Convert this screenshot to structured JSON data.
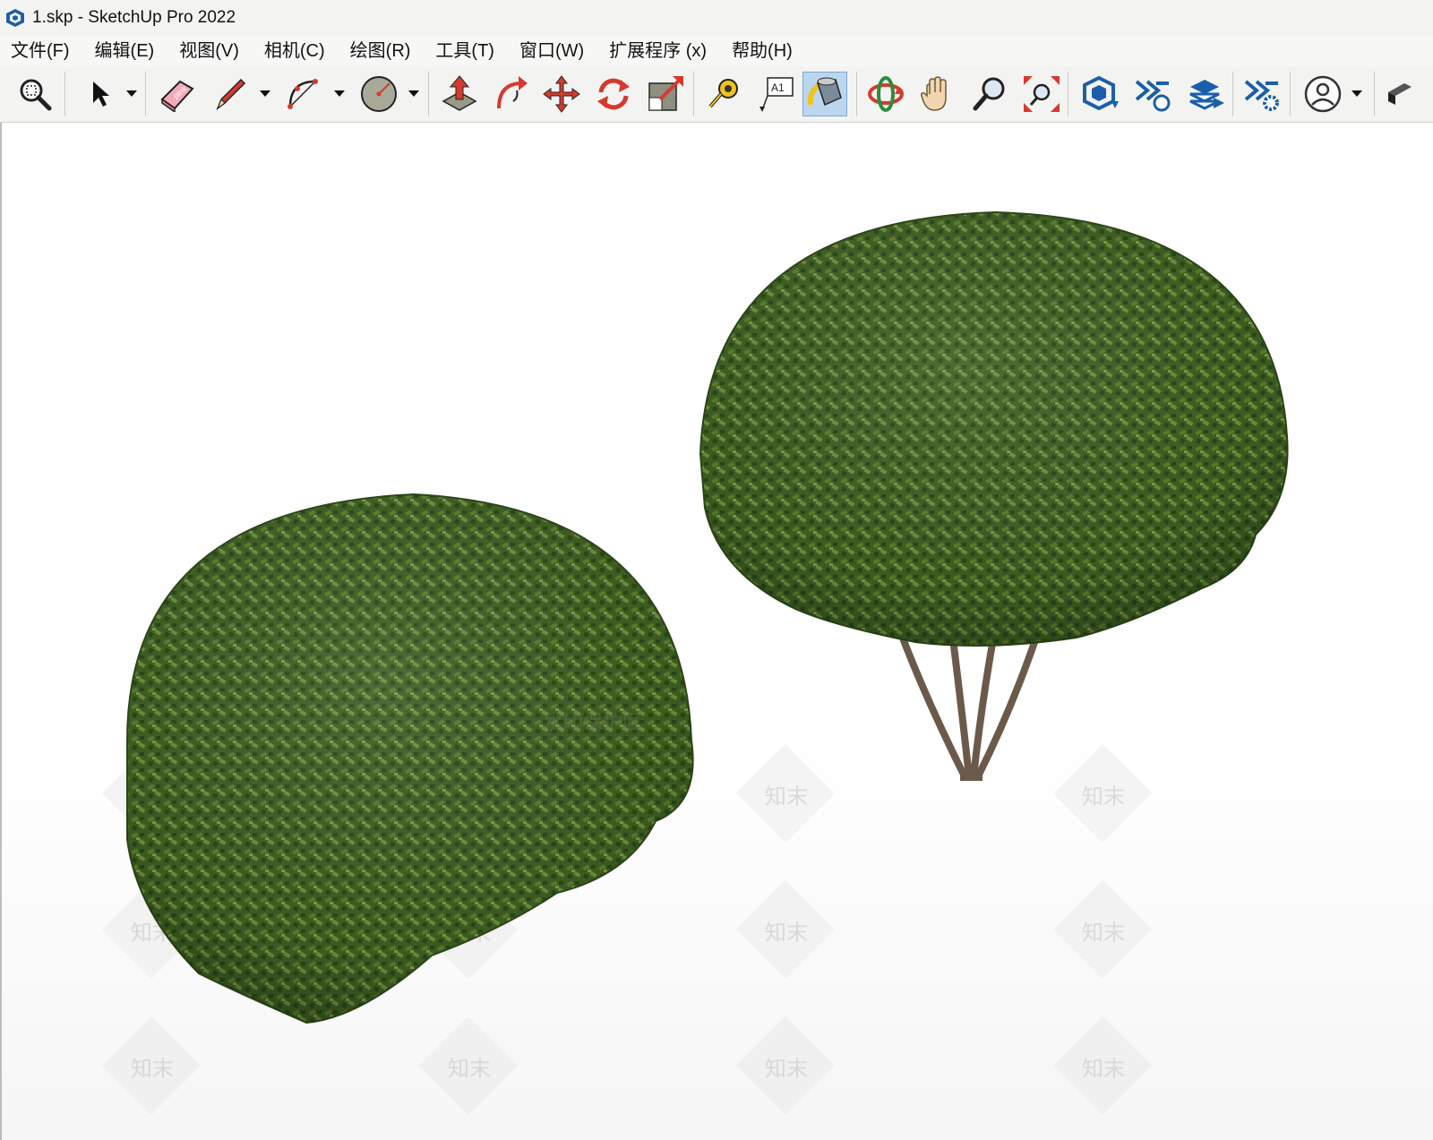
{
  "window": {
    "title": "1.skp - SketchUp Pro 2022"
  },
  "menu": [
    {
      "label": "文件(F)"
    },
    {
      "label": "编辑(E)"
    },
    {
      "label": "视图(V)"
    },
    {
      "label": "相机(C)"
    },
    {
      "label": "绘图(R)"
    },
    {
      "label": "工具(T)"
    },
    {
      "label": "窗口(W)"
    },
    {
      "label": "扩展程序 (x)"
    },
    {
      "label": "帮助(H)"
    }
  ],
  "toolbar": {
    "tools": [
      {
        "icon": "zoom-window-icon"
      },
      {
        "icon": "select-icon"
      },
      {
        "icon": "eraser-icon"
      },
      {
        "icon": "pencil-icon"
      },
      {
        "icon": "arc-icon"
      },
      {
        "icon": "circle-icon"
      },
      {
        "icon": "push-pull-icon"
      },
      {
        "icon": "follow-me-icon"
      },
      {
        "icon": "move-icon"
      },
      {
        "icon": "rotate-icon"
      },
      {
        "icon": "scale-icon"
      },
      {
        "icon": "tape-measure-icon"
      },
      {
        "icon": "text-icon"
      },
      {
        "icon": "paint-bucket-icon"
      },
      {
        "icon": "orbit-icon"
      },
      {
        "icon": "pan-icon"
      },
      {
        "icon": "zoom-icon"
      },
      {
        "icon": "zoom-extents-icon"
      },
      {
        "icon": "3d-warehouse-icon"
      },
      {
        "icon": "extension-warehouse-icon"
      },
      {
        "icon": "layout-send-icon"
      },
      {
        "icon": "extension-manager-icon"
      },
      {
        "icon": "user-account-icon"
      }
    ],
    "text_tool_label": "A1",
    "eraser_label": "pink",
    "active_tool": "paint-bucket-icon"
  },
  "viewport": {
    "watermark_text": "水印保护区",
    "watermark_brand": "知末",
    "scene_objects": [
      "shrub-sphere",
      "tree-shrub"
    ],
    "colors": {
      "foliage_dark": "#2f4f1a",
      "foliage_mid": "#4a6b2a",
      "foliage_light": "#6e8f3c",
      "trunk": "#6b5a4a"
    }
  }
}
